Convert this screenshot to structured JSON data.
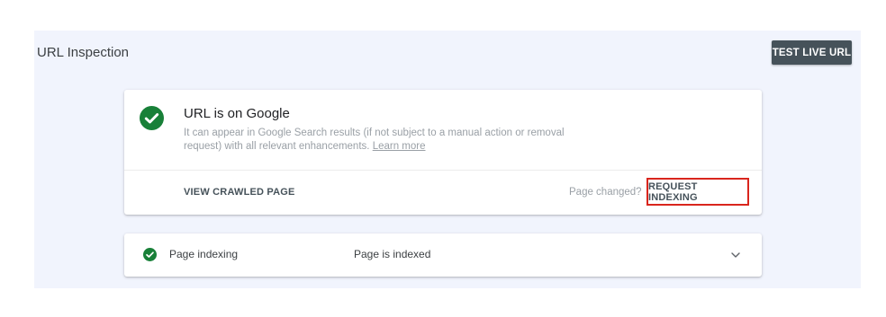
{
  "header": {
    "title": "URL Inspection",
    "test_live_label": "TEST LIVE URL"
  },
  "status_card": {
    "icon": "check-circle-icon",
    "title": "URL is on Google",
    "description": "It can appear in Google Search results (if not subject to a manual action or removal request) with all relevant enhancements.",
    "learn_more": "Learn more",
    "view_crawled_label": "VIEW CRAWLED PAGE",
    "page_changed": "Page changed?",
    "request_indexing_label": "REQUEST INDEXING"
  },
  "indexing_row": {
    "icon": "check-circle-icon",
    "label": "Page indexing",
    "value": "Page is indexed",
    "expand_icon": "chevron-down-icon"
  },
  "colors": {
    "panel_bg": "#f1f4fd",
    "success_green": "#188038",
    "button_dark": "#46525a",
    "highlight_red": "#d9251d"
  }
}
